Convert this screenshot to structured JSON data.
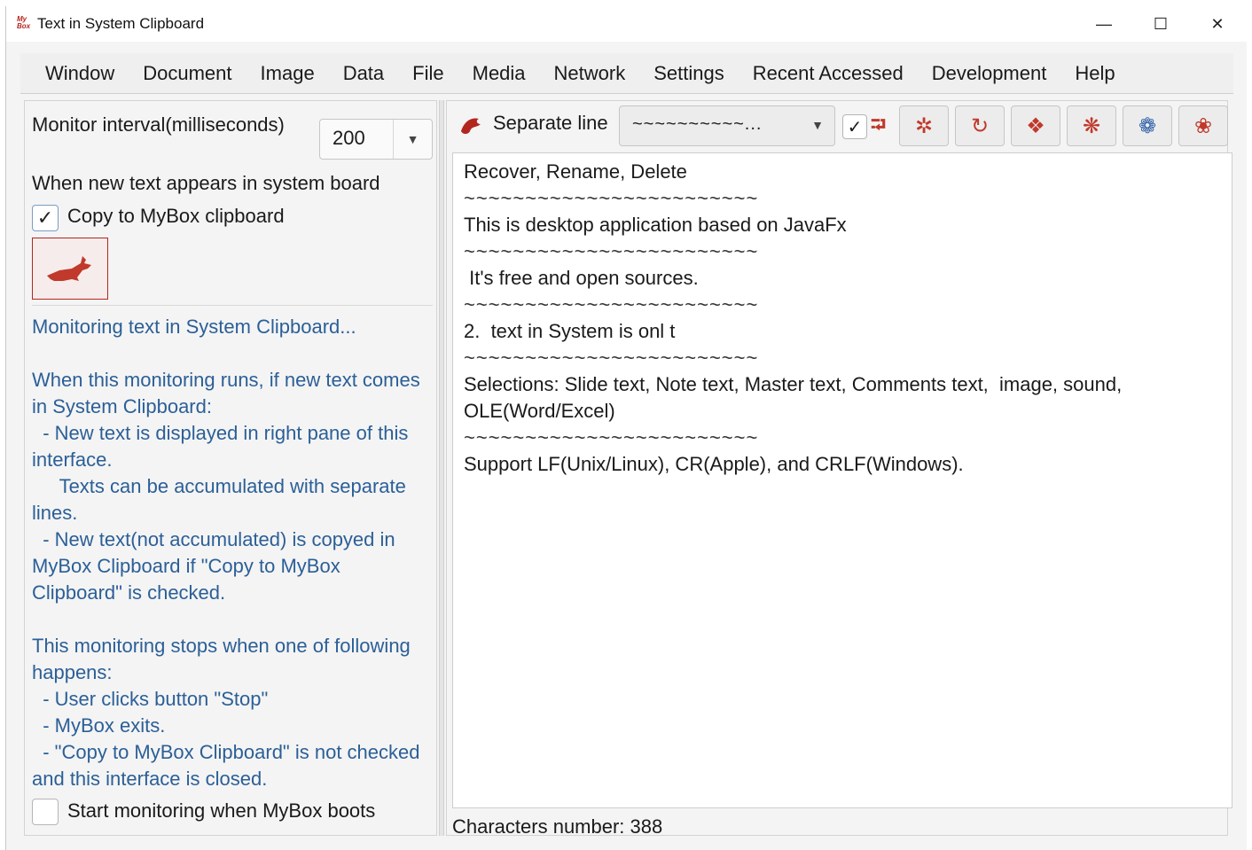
{
  "window": {
    "title": "Text in System Clipboard",
    "app_icon_text": "My Box",
    "minimize_glyph": "—",
    "maximize_glyph": "☐",
    "close_glyph": "✕"
  },
  "menu": [
    "Window",
    "Document",
    "Image",
    "Data",
    "File",
    "Media",
    "Network",
    "Settings",
    "Recent Accessed",
    "Development",
    "Help"
  ],
  "left": {
    "monitor_label": "Monitor interval(milliseconds)",
    "interval_value": "200",
    "new_text_label": "When new text appears in system board",
    "copy_checkbox_label": "Copy to MyBox clipboard",
    "copy_checked": true,
    "check_glyph": "✓",
    "start_button_icon": "deer-icon",
    "help_text": "Monitoring text in System Clipboard...\n\nWhen this monitoring runs, if new text comes in System Clipboard:\n  - New text is displayed in right pane of this interface.\n     Texts can be accumulated with separate lines.\n  - New text(not accumulated) is copyed in MyBox Clipboard if \"Copy to MyBox Clipboard\" is checked.\n\nThis monitoring stops when one of following happens:\n  - User clicks button \"Stop\"\n  - MyBox exits.\n  - \"Copy to MyBox Clipboard\" is not checked and this interface is closed.",
    "start_boot_label": "Start monitoring when MyBox boots",
    "start_boot_checked": false
  },
  "right": {
    "separate_line_label": "Separate line",
    "separate_line_value": "~~~~~~~~~~...",
    "wrap_checked": true,
    "wrap_glyph": "⮒",
    "toolbar_buttons": [
      {
        "name": "star-icon",
        "glyph": "✲",
        "color": "red"
      },
      {
        "name": "undo-icon",
        "glyph": "↻",
        "color": "red"
      },
      {
        "name": "clear-icon",
        "glyph": "❖",
        "color": "red"
      },
      {
        "name": "flower-icon",
        "glyph": "❋",
        "color": "red"
      },
      {
        "name": "copy-icon",
        "glyph": "❁",
        "color": "blue"
      },
      {
        "name": "paste-icon",
        "glyph": "❀",
        "color": "red"
      }
    ],
    "lines": [
      "Recover, Rename, Delete",
      "~~~~~~~~~~~~~~~~~~~~~~~~",
      "This is desktop application based on JavaFx",
      "~~~~~~~~~~~~~~~~~~~~~~~~",
      " It's free and open sources.",
      "~~~~~~~~~~~~~~~~~~~~~~~~",
      "2.  text in System is onl t",
      "~~~~~~~~~~~~~~~~~~~~~~~~",
      "Selections: Slide text, Note text, Master text, Comments text,  image, sound,",
      "OLE(Word/Excel)",
      "~~~~~~~~~~~~~~~~~~~~~~~~",
      "Support LF(Unix/Linux), CR(Apple), and CRLF(Windows)."
    ],
    "char_count": "Characters number: 388"
  },
  "colors": {
    "accent_red": "#b3261e",
    "help_text_blue": "#2b5f97",
    "icon_blue": "#2d5fa8"
  }
}
